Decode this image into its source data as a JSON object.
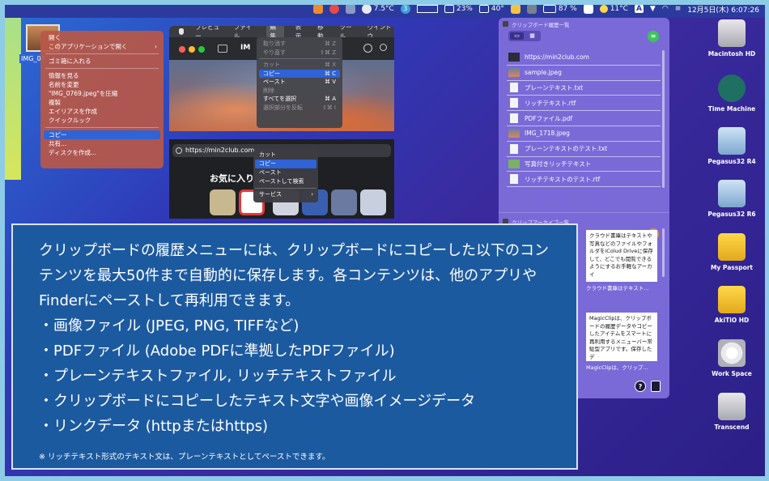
{
  "menubar": {
    "temperature": "7.5°C",
    "badge_count": "3",
    "cpu_percent": "23%",
    "cpu_temp": "40°",
    "battery": "87 %",
    "weather_temp": "11°C",
    "keyboard_input": "A",
    "datetime": "12月5日(木) 6:07:26",
    "colors": {
      "bar": "#2c3a9e"
    }
  },
  "finder": {
    "file_label": "IMG_07",
    "context_menu": [
      {
        "label": "開く",
        "type": "item"
      },
      {
        "label": "このアプリケーションで開く",
        "type": "item",
        "submenu": true
      },
      {
        "type": "separator"
      },
      {
        "label": "ゴミ箱に入れる",
        "type": "item"
      },
      {
        "type": "separator"
      },
      {
        "label": "情報を見る",
        "type": "item"
      },
      {
        "label": "名前を変更",
        "type": "item"
      },
      {
        "label": "\"IMG_0769.jpeg\"を圧縮",
        "type": "item"
      },
      {
        "label": "複製",
        "type": "item"
      },
      {
        "label": "エイリアスを作成",
        "type": "item"
      },
      {
        "label": "クイックルック",
        "type": "item"
      },
      {
        "type": "separator"
      },
      {
        "label": "コピー",
        "type": "item",
        "selected": true
      },
      {
        "label": "共有...",
        "type": "item"
      },
      {
        "label": "ディスクを作成...",
        "type": "item"
      }
    ]
  },
  "preview": {
    "menus": [
      "プレビュー",
      "ファイル",
      "編集",
      "表示",
      "移動",
      "ツール",
      "ウインドウ"
    ],
    "active_menu": "編集",
    "toolbar_title": "IM",
    "edit_menu": [
      {
        "label": "取り消す",
        "shortcut": "⌘ Z",
        "dim": true
      },
      {
        "label": "やり直す",
        "shortcut": "⇧⌘ Z",
        "dim": true
      },
      {
        "type": "separator"
      },
      {
        "label": "カット",
        "shortcut": "⌘ X",
        "dim": true
      },
      {
        "label": "コピー",
        "shortcut": "⌘ C",
        "selected": true
      },
      {
        "label": "ペースト",
        "shortcut": "⌘ V"
      },
      {
        "label": "削除",
        "shortcut": "",
        "dim": true
      },
      {
        "label": "すべてを選択",
        "shortcut": "⌘ A"
      },
      {
        "label": "選択部分を反転",
        "shortcut": "⇧⌘ I",
        "dim": true
      }
    ]
  },
  "safari": {
    "url": "https://min2club.com",
    "favorites_title": "お気に入り",
    "context_menu": [
      {
        "label": "カット"
      },
      {
        "label": "コピー",
        "selected": true
      },
      {
        "label": "ペースト"
      },
      {
        "label": "ペーストして検索"
      },
      {
        "type": "separator"
      },
      {
        "label": "サービス",
        "submenu": true
      }
    ]
  },
  "clipboard_panel": {
    "history_title": "クリップボード履歴一覧",
    "archive_title": "クリップアーカイブ一覧",
    "accent": "#7a6ad8",
    "items": [
      {
        "label": "https://min2club.com",
        "kind": "link"
      },
      {
        "label": "sample.jpeg",
        "kind": "image"
      },
      {
        "label": "プレーンテキスト.txt",
        "kind": "doc"
      },
      {
        "label": "リッチテキスト.rtf",
        "kind": "doc"
      },
      {
        "label": "PDFファイル.pdf",
        "kind": "doc"
      },
      {
        "label": "IMG_1718.jpeg",
        "kind": "image"
      },
      {
        "label": "プレーンテキストのテスト.txt",
        "kind": "doc"
      },
      {
        "label": "写真付きリッチテキスト",
        "kind": "richimage"
      },
      {
        "label": "リッチテキストのテスト.rtf",
        "kind": "doc"
      }
    ],
    "archive": [
      {
        "text": "クラウド書庫はテキストや写真などのファイルやフォルダをiColud Driveに保存して、どこでも閲覧できるようにするお手軽なアーカイ",
        "caption": "クラウド書庫はテキスト..."
      },
      {
        "text": "MagicClipは、クリップボードの履歴データやコピーしたアイテムをスマートに再利用するメニューバー常駐型アプリです。保存したデ",
        "caption": "MagicClipは、クリップ..."
      }
    ],
    "help_label": "?"
  },
  "desktop_icons": [
    {
      "label": "Macintosh HD",
      "icon": "internal-disk-icon"
    },
    {
      "label": "Time Machine",
      "icon": "time-machine-icon"
    },
    {
      "label": "Pegasus32 R4",
      "icon": "external-disk-icon"
    },
    {
      "label": "Pegasus32 R6",
      "icon": "external-disk-icon"
    },
    {
      "label": "My Passport",
      "icon": "starfleet-disk-icon"
    },
    {
      "label": "AkiTiO HD",
      "icon": "starfleet-disk-icon"
    },
    {
      "label": "Work Space",
      "icon": "shield-disk-icon"
    },
    {
      "label": "Transcend",
      "icon": "internal-disk-icon"
    }
  ],
  "info_box": {
    "paragraph": "クリップボードの履歴メニューには、クリップボードにコピーした以下のコンテンツを最大50件まで自動的に保存します。各コンテンツは、他のアプリやFinderにペーストして再利用できます。",
    "bullets": [
      "・画像ファイル (JPEG, PNG, TIFFなど)",
      "・PDFファイル (Adobe PDFに準拠したPDFファイル)",
      "・プレーンテキストファイル, リッチテキストファイル",
      "・クリップボードにコピーしたテキスト文字や画像イメージデータ",
      "・リンクデータ (httpまたはhttps)"
    ],
    "note": "※ リッチテキスト形式のテキスト文は、プレーンテキストとしてペーストできます。",
    "background": "#1c5aa0"
  }
}
